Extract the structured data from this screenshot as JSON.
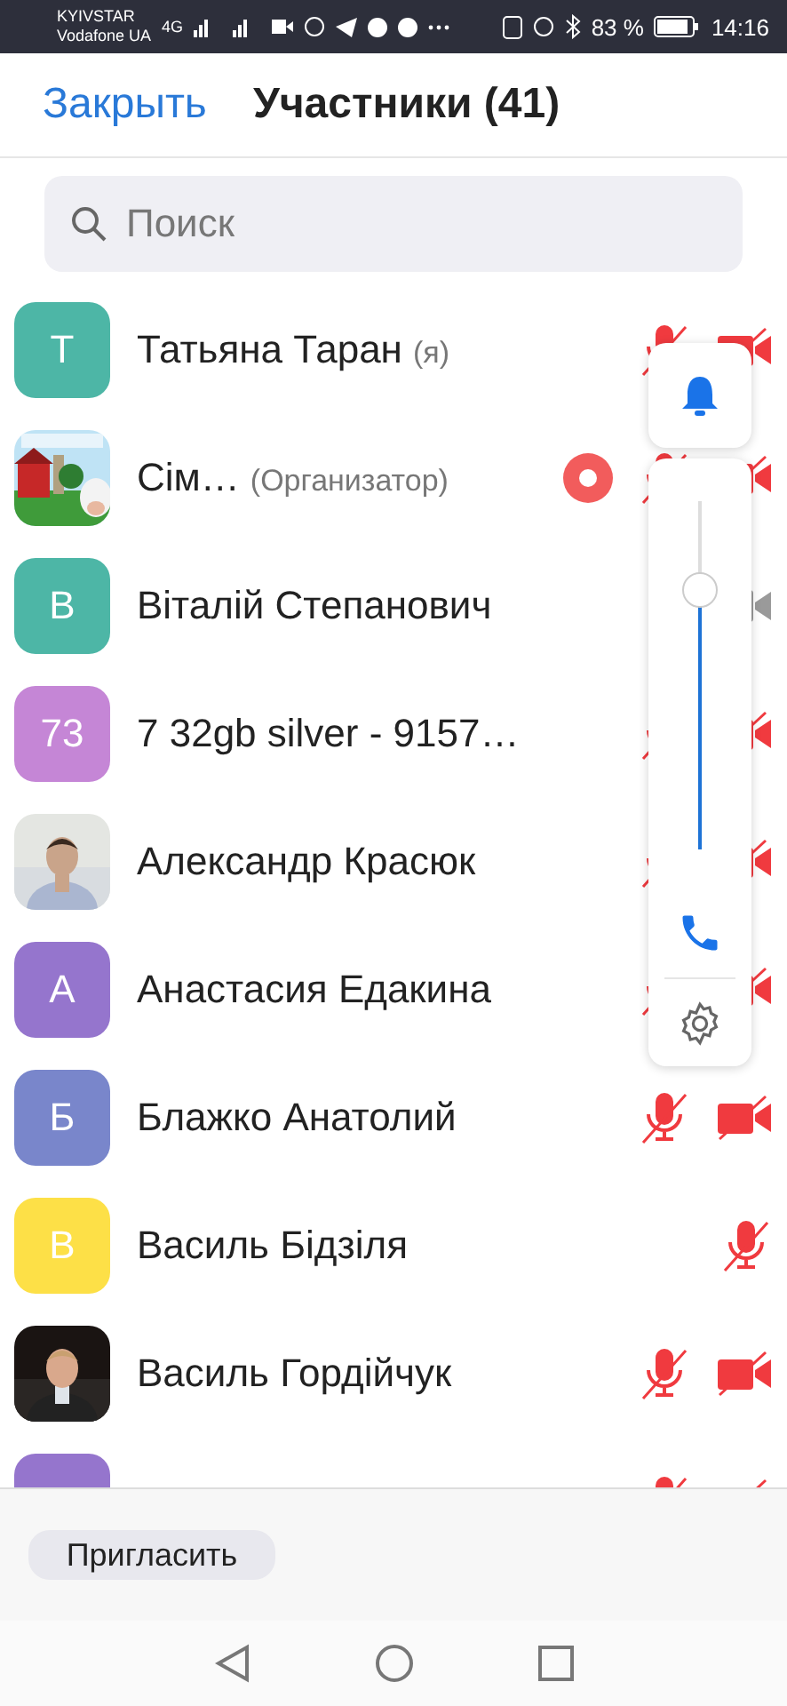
{
  "status_bar": {
    "carrier_1": "KYIVSTAR",
    "carrier_2": "Vodafone UA",
    "network": "4G",
    "battery": "83 %",
    "time": "14:16"
  },
  "header": {
    "close": "Закрыть",
    "title": "Участники (41)"
  },
  "search": {
    "placeholder": "Поиск"
  },
  "participants": [
    {
      "name": "Татьяна Таран",
      "tag": "(я)",
      "avatar": {
        "kind": "letter",
        "text": "Т",
        "color": "#4db6a6"
      },
      "mic_muted": true,
      "video_muted": true
    },
    {
      "name": "Сім…",
      "tag": "(Организатор)",
      "recording": true,
      "mic_muted": true,
      "video_muted": true
    },
    {
      "name": "Віталій Степанович",
      "avatar": {
        "kind": "letter",
        "text": "В",
        "color": "#4db6a6"
      },
      "video_muted": false
    },
    {
      "name": "7 32gb silver - 9157…",
      "avatar": {
        "kind": "letter",
        "text": "73",
        "color": "#c586d6"
      },
      "mic_muted": true,
      "video_muted": true
    },
    {
      "name": "Александр Красюк",
      "mic_muted": true,
      "video_muted": true
    },
    {
      "name": "Анастасия Едакина",
      "avatar": {
        "kind": "letter",
        "text": "А",
        "color": "#9575cd"
      },
      "mic_muted": true,
      "video_muted": true
    },
    {
      "name": "Блажко Анатолий",
      "avatar": {
        "kind": "letter",
        "text": "Б",
        "color": "#7986cb"
      },
      "mic_muted": true,
      "video_muted": true
    },
    {
      "name": "Василь Бідзіля",
      "avatar": {
        "kind": "letter",
        "text": "В",
        "color": "#fde047"
      },
      "mic_muted": true
    },
    {
      "name": "Василь Гордійчук",
      "mic_muted": true,
      "video_muted": true
    },
    {
      "avatar": {
        "kind": "blank",
        "color": "#9575cd"
      },
      "mic_muted": true,
      "video_muted": true
    }
  ],
  "audio_panel": {
    "volume": {
      "level": 0.745
    }
  },
  "footer": {
    "invite": "Пригласить"
  }
}
